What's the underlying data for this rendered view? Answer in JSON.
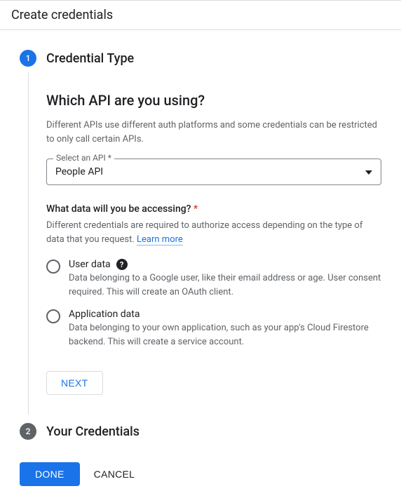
{
  "header": {
    "title": "Create credentials"
  },
  "step1": {
    "number": "1",
    "title": "Credential Type",
    "sectionHeading": "Which API are you using?",
    "sectionDesc": "Different APIs use different auth platforms and some credentials can be restricted to only call certain APIs.",
    "select": {
      "label": "Select an API *",
      "value": "People API"
    },
    "question": {
      "label": "What data will you be accessing?",
      "required": "*",
      "desc": "Different credentials are required to authorize access depending on the type of data that you request. ",
      "learnMore": "Learn more"
    },
    "options": [
      {
        "label": "User data",
        "hasHelp": true,
        "desc": "Data belonging to a Google user, like their email address or age. User consent required. This will create an OAuth client."
      },
      {
        "label": "Application data",
        "hasHelp": false,
        "desc": "Data belonging to your own application, such as your app's Cloud Firestore backend. This will create a service account."
      }
    ],
    "nextLabel": "NEXT"
  },
  "step2": {
    "number": "2",
    "title": "Your Credentials"
  },
  "actions": {
    "done": "DONE",
    "cancel": "CANCEL"
  }
}
